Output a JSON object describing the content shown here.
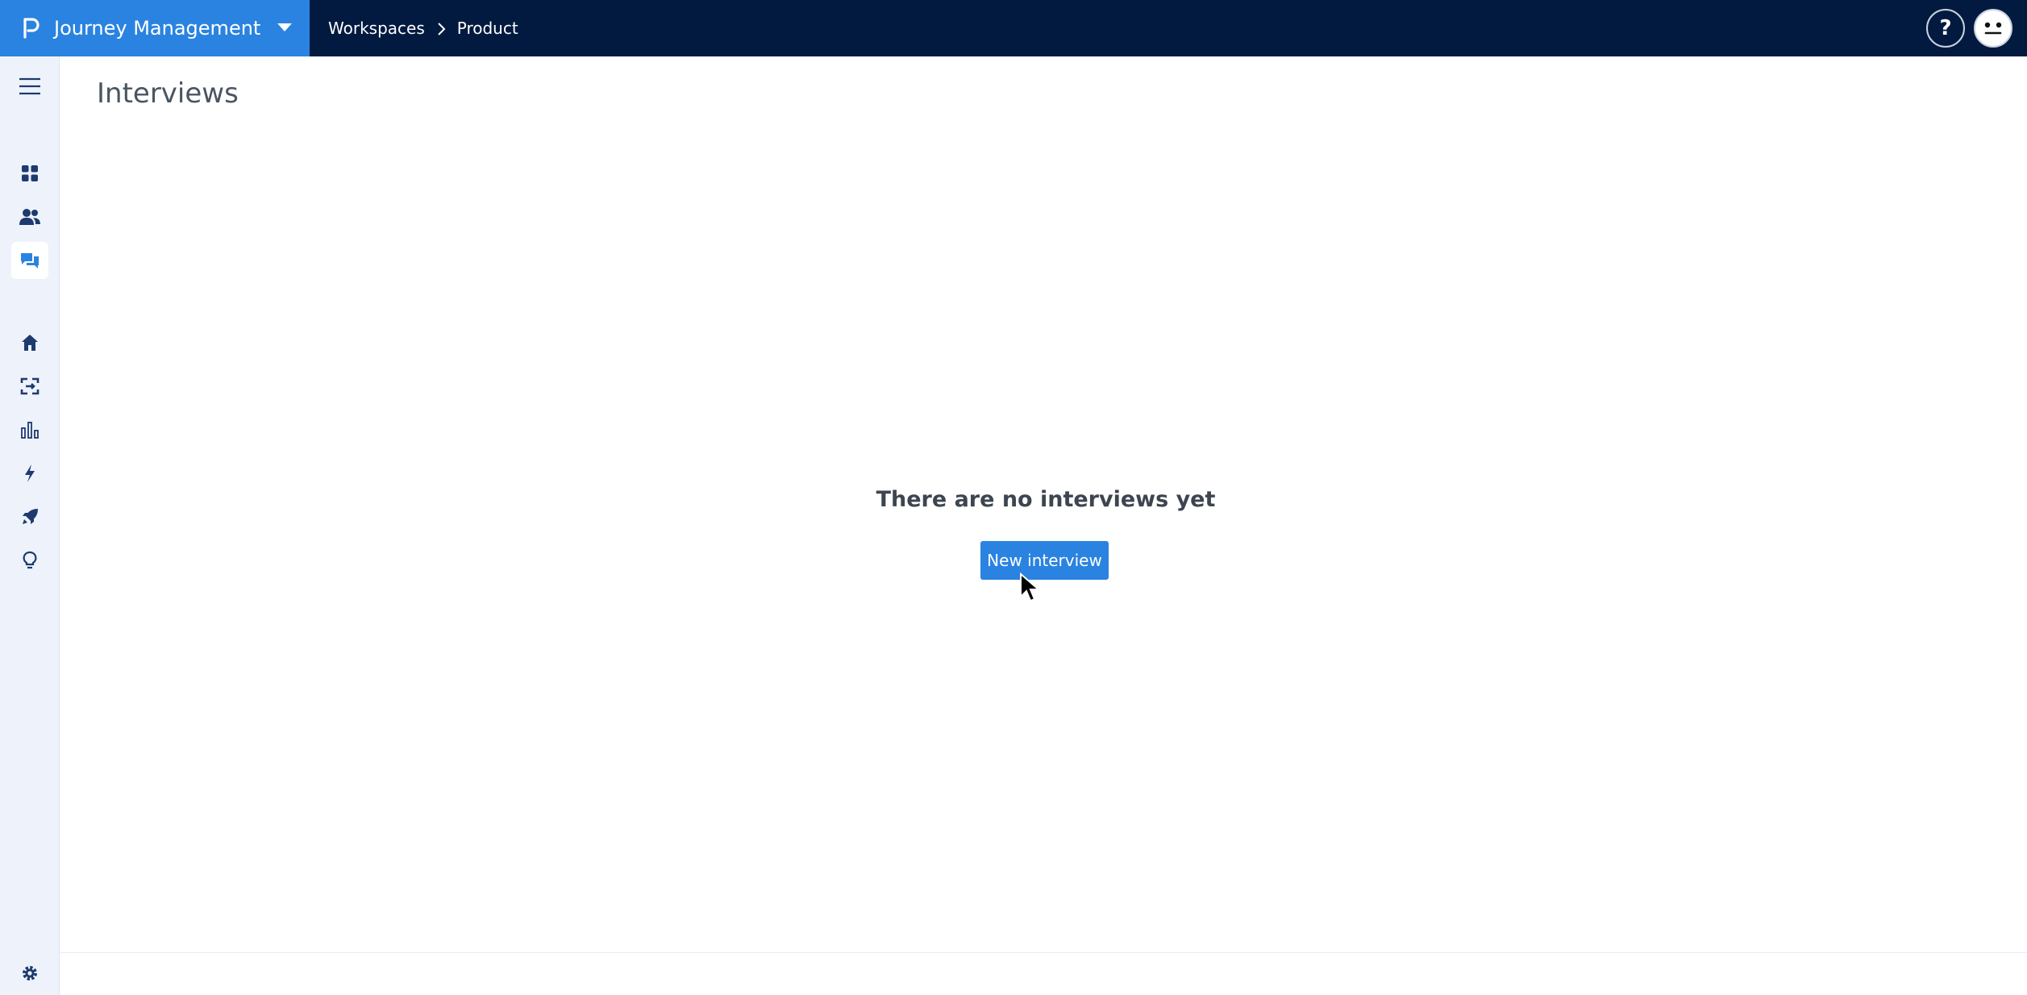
{
  "header": {
    "app_name": "Journey Management",
    "breadcrumb": {
      "parent": "Workspaces",
      "current": "Product"
    },
    "help_label": "?"
  },
  "sidebar": {
    "items": [
      {
        "name": "menu-icon",
        "active": false
      },
      {
        "name": "dashboard-icon",
        "active": false
      },
      {
        "name": "users-icon",
        "active": false
      },
      {
        "name": "interviews-icon",
        "active": true
      },
      {
        "name": "home-icon",
        "active": false
      },
      {
        "name": "journey-icon",
        "active": false
      },
      {
        "name": "analytics-icon",
        "active": false
      },
      {
        "name": "bolt-icon",
        "active": false
      },
      {
        "name": "rocket-icon",
        "active": false
      },
      {
        "name": "lightbulb-icon",
        "active": false
      },
      {
        "name": "settings-icon",
        "active": false
      }
    ]
  },
  "main": {
    "title": "Interviews",
    "empty_message": "There are no interviews yet",
    "new_button_label": "New interview"
  },
  "colors": {
    "topbar": "#021a40",
    "accent": "#2a83e0",
    "sidebar_bg": "#eef3fb",
    "icon": "#1e3a6e"
  }
}
